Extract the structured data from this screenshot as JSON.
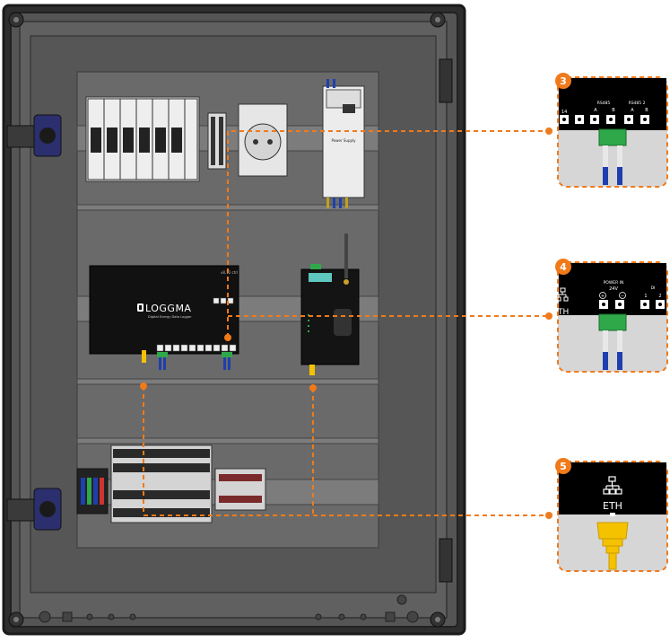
{
  "controller": {
    "brand": "LOGGMA",
    "subtitle": "Digital Energy Data Logger",
    "corner_label": "v8.12 ctrl"
  },
  "power_supply": {
    "label": "Power Supply"
  },
  "callouts": [
    {
      "number": "3",
      "top_labels": [
        "RS485",
        "RS485 2"
      ],
      "sub_labels": [
        "A",
        "B",
        "A",
        "B"
      ],
      "left_edge_label": "14"
    },
    {
      "number": "4",
      "left_label": "TH",
      "power_label": "POWER IN",
      "voltage_label": "24V",
      "plus_symbol": "+",
      "minus_symbol": "−",
      "di_label": "DI",
      "di_numbers": [
        "1",
        "2"
      ]
    },
    {
      "number": "5",
      "port_label": "ETH"
    }
  ],
  "colors": {
    "accent": "#f07a1a",
    "enclosure": "#4b4b4b",
    "enclosure_light": "#6a6a6a",
    "device_dark": "#111111",
    "wire_blue": "#1f3fae",
    "terminal_green": "#2fa84a",
    "eth_yellow": "#f5c200",
    "callout_bg": "#d6d6d6"
  }
}
